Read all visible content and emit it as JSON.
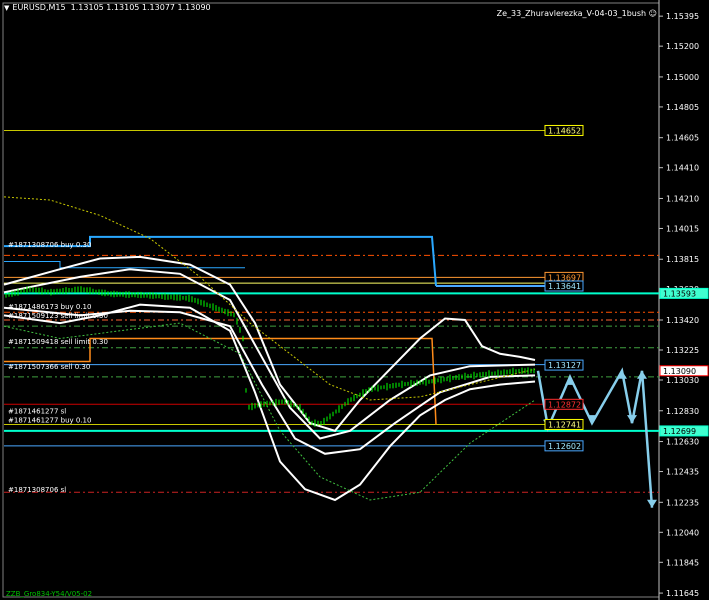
{
  "header": {
    "symbol": "EURUSD,M15",
    "ohlc": "1.13105 1.13105 1.13077 1.13090"
  },
  "indicator_name": "Ze_33_Zhuravlerezka_V-04-03_1bush",
  "footer_text": "ZZB_Gro834-Y54/V05-02",
  "colors": {
    "background": "#000000",
    "candles": "#00ff00",
    "bands": "#ffffff",
    "arrows": "#87ceeb",
    "axis_text": "#ffffff"
  },
  "chart_data": {
    "type": "line",
    "title": "EURUSD,M15",
    "y_ticks": [
      "1.15395",
      "1.15200",
      "1.15000",
      "1.14805",
      "1.14605",
      "1.14410",
      "1.14210",
      "1.14015",
      "1.13815",
      "1.13620",
      "1.13420",
      "1.13225",
      "1.13030",
      "1.12830",
      "1.12630",
      "1.12435",
      "1.12235",
      "1.12040",
      "1.11845",
      "1.11645"
    ],
    "ylim": [
      1.116,
      1.155
    ],
    "current_price": "1.13090",
    "price_labels": [
      {
        "text": "1.14652",
        "value": 1.14652,
        "color": "#ffff80",
        "border": "#ffff00"
      },
      {
        "text": "1.13697",
        "value": 1.13697,
        "color": "#ff9933",
        "border": "#ff9933"
      },
      {
        "text": "1.13641",
        "value": 1.13641,
        "color": "#9fe7ff",
        "border": "#4aa8ff"
      },
      {
        "text": "1.13593",
        "value": 1.13593,
        "color": "#000000",
        "border": "#00ffcc",
        "fill": "#40ffd0",
        "on_axis": true
      },
      {
        "text": "1.13127",
        "value": 1.13127,
        "color": "#9fe7ff",
        "border": "#4aa8ff"
      },
      {
        "text": "1.13090",
        "value": 1.1309,
        "color": "#000000",
        "border": "#ff0000",
        "fill": "#ffffff",
        "on_axis": true
      },
      {
        "text": "1.12872",
        "value": 1.12872,
        "color": "#ff3030",
        "border": "#ff3030"
      },
      {
        "text": "1.12741",
        "value": 1.12741,
        "color": "#ffff80",
        "border": "#ffff00"
      },
      {
        "text": "1.12699",
        "value": 1.12699,
        "color": "#000000",
        "border": "#00ffcc",
        "fill": "#40ffd0",
        "on_axis": true
      },
      {
        "text": "1.12602",
        "value": 1.12602,
        "color": "#9fe7ff",
        "border": "#4aa8ff"
      }
    ],
    "order_labels": [
      {
        "text": "#1871308706 buy 0.30",
        "value": 1.1388
      },
      {
        "text": "#1871486173 buy 0.10",
        "value": 1.1348
      },
      {
        "text": "#1871509123 sell limit 0.30",
        "value": 1.1342
      },
      {
        "text": "#1871509418 sell limit 0.30",
        "value": 1.1325
      },
      {
        "text": "#1871507366 sell 0.30",
        "value": 1.1309
      },
      {
        "text": "#1871461277 sl",
        "value": 1.128
      },
      {
        "text": "#1871461277 buy 0.10",
        "value": 1.1274
      },
      {
        "text": "#1871308706 sl",
        "value": 1.1229
      }
    ]
  }
}
